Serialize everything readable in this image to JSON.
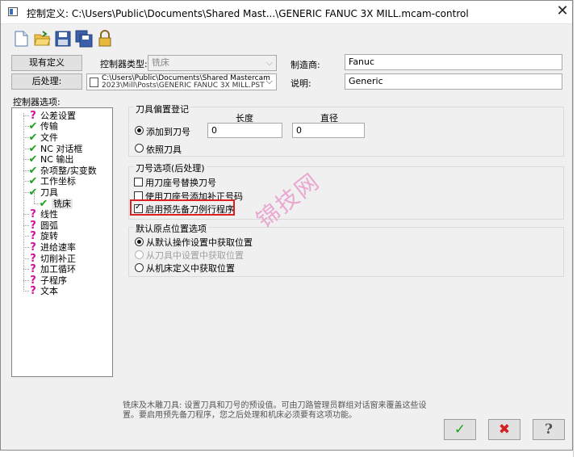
{
  "window": {
    "title": "控制定义: C:\\Users\\Public\\Documents\\Shared Mast...\\GENERIC FANUC 3X MILL.mcam-control",
    "close_glyph": "✕"
  },
  "toolbar": {
    "icons": [
      "new-file-icon",
      "open-folder-icon",
      "save-icon",
      "save-as-icon",
      "lock-icon"
    ]
  },
  "header": {
    "current_def_button": "现有定义",
    "post_button": "后处理:",
    "controller_type_label": "控制器类型:",
    "controller_type_value": "铣床",
    "post_path_line1": "C:\\Users\\Public\\Documents\\Shared Mastercam",
    "post_path_line2": "2023\\Mill\\Posts\\GENERIC FANUC 3X MILL.PST",
    "manufacturer_label": "制造商:",
    "manufacturer_value": "Fanuc",
    "description_label": "说明:",
    "description_value": "Generic"
  },
  "tree": {
    "label": "控制器选项:",
    "items": [
      {
        "label": "公差设置",
        "status": "question",
        "level": 1
      },
      {
        "label": "传输",
        "status": "check",
        "level": 1
      },
      {
        "label": "文件",
        "status": "check",
        "level": 1
      },
      {
        "label": "NC 对话框",
        "status": "check",
        "level": 1
      },
      {
        "label": "NC 输出",
        "status": "check",
        "level": 1
      },
      {
        "label": "杂项整/实变数",
        "status": "check",
        "level": 1
      },
      {
        "label": "工作坐标",
        "status": "check",
        "level": 1
      },
      {
        "label": "刀具",
        "status": "check",
        "level": 1
      },
      {
        "label": "铣床",
        "status": "check",
        "level": 2,
        "selected": true
      },
      {
        "label": "线性",
        "status": "question",
        "level": 1
      },
      {
        "label": "圆弧",
        "status": "question",
        "level": 1
      },
      {
        "label": "旋转",
        "status": "question",
        "level": 1
      },
      {
        "label": "进给速率",
        "status": "question",
        "level": 1
      },
      {
        "label": "切削补正",
        "status": "question",
        "level": 1
      },
      {
        "label": "加工循环",
        "status": "question",
        "level": 1
      },
      {
        "label": "子程序",
        "status": "question",
        "level": 1
      },
      {
        "label": "文本",
        "status": "question",
        "level": 1
      }
    ]
  },
  "offset_group": {
    "title": "刀具偏置登记",
    "length_label": "长度",
    "diameter_label": "直径",
    "add_to_tool_number": "添加到刀号",
    "length_value": "0",
    "diameter_value": "0",
    "by_tool": "依照刀具"
  },
  "tool_number_group": {
    "title": "刀号选项(后处理)",
    "opt1": "用刀座号替换刀号",
    "opt2": "使用刀座号添加补正号码",
    "opt3": "启用预先备刀例行程序"
  },
  "home_group": {
    "title": "默认原点位置选项",
    "opt1": "从默认操作设置中获取位置",
    "opt2": "从刀具中设置中获取位置",
    "opt3": "从机床定义中获取位置"
  },
  "description_text": "铣床及木雕刀具: 设置刀具和刀号的预设值。可由刀路管理员群组对话窗来覆盖这些设置。要启用预先备刀程序，您之后处理和机床必须要有这项功能。",
  "footer": {
    "ok_glyph": "✓",
    "cancel_glyph": "✖",
    "help_glyph": "?"
  },
  "watermark": "锦技网",
  "colors": {
    "highlight_box": "#e02020",
    "ok_green": "#1ea01e",
    "cancel_red": "#d42020",
    "question_magenta": "#d0109a"
  }
}
